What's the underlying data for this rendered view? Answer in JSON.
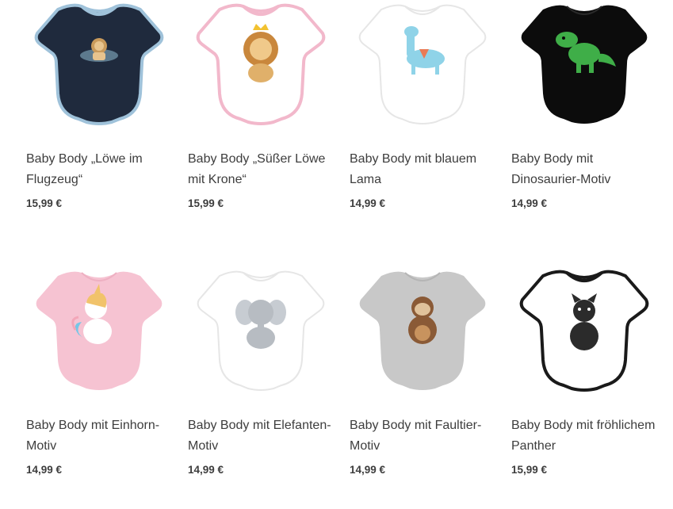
{
  "products": [
    {
      "title": "Baby Body „Löwe im Flugzeug“",
      "price": "15,99 €",
      "icon": "lion-airplane-icon",
      "body_color": "#1f2a3d",
      "trim_color": "#9fc2da",
      "motif_color": "#c99a5b"
    },
    {
      "title": "Baby Body „Süßer Löwe mit Krone“",
      "price": "15,99 €",
      "icon": "lion-crown-icon",
      "body_color": "#ffffff",
      "trim_color": "#f2b8cb",
      "motif_color": "#d39a4c"
    },
    {
      "title": "Baby Body mit blauem Lama",
      "price": "14,99 €",
      "icon": "llama-icon",
      "body_color": "#ffffff",
      "trim_color": "#ffffff",
      "motif_color": "#8fd3e8"
    },
    {
      "title": "Baby Body mit Dinosaurier-Motiv",
      "price": "14,99 €",
      "icon": "dinosaur-icon",
      "body_color": "#0c0c0c",
      "trim_color": "#0c0c0c",
      "motif_color": "#3fae48"
    },
    {
      "title": "Baby Body mit Einhorn-Motiv",
      "price": "14,99 €",
      "icon": "unicorn-icon",
      "body_color": "#f6c3d2",
      "trim_color": "#f6c3d2",
      "motif_color": "#ffffff"
    },
    {
      "title": "Baby Body mit Elefanten-Motiv",
      "price": "14,99 €",
      "icon": "elephant-icon",
      "body_color": "#ffffff",
      "trim_color": "#ffffff",
      "motif_color": "#b7bcc2"
    },
    {
      "title": "Baby Body mit Faultier-Motiv",
      "price": "14,99 €",
      "icon": "sloth-icon",
      "body_color": "#c8c8c8",
      "trim_color": "#c8c8c8",
      "motif_color": "#8a5a36"
    },
    {
      "title": "Baby Body mit fröhlichem Panther",
      "price": "15,99 €",
      "icon": "panther-icon",
      "body_color": "#ffffff",
      "trim_color": "#1a1a1a",
      "motif_color": "#2b2b2b"
    }
  ]
}
